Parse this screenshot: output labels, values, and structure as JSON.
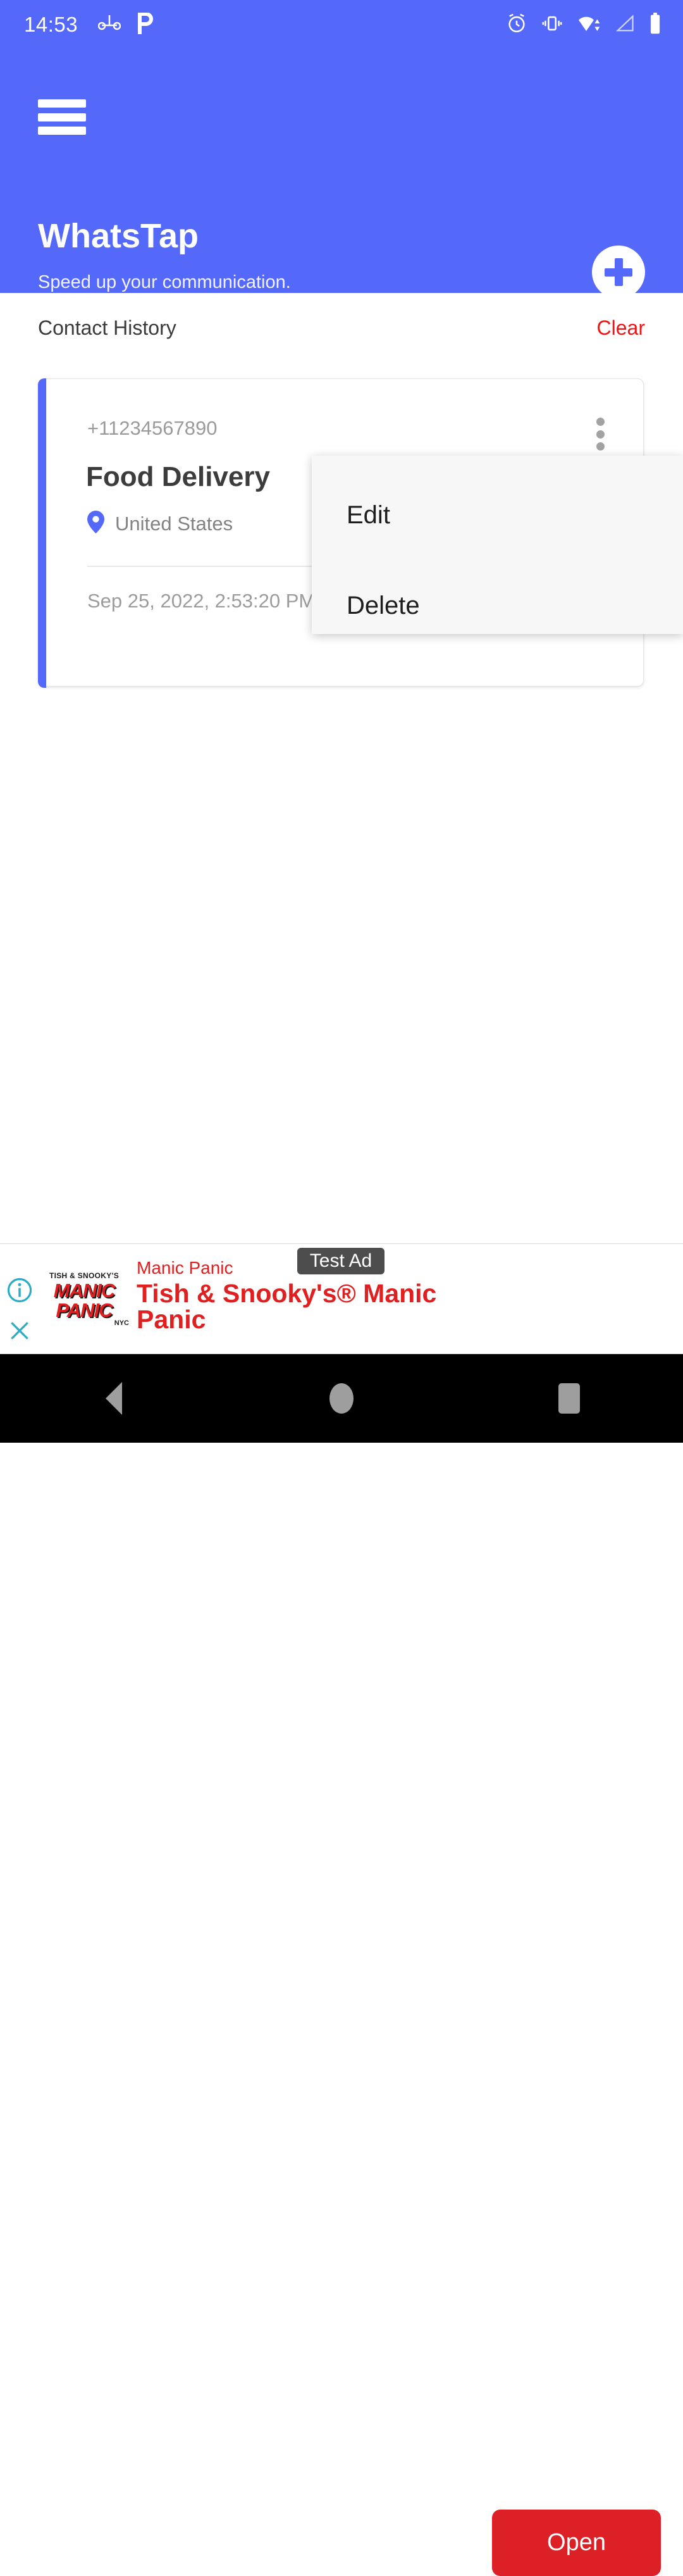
{
  "status_bar": {
    "time": "14:53",
    "left_icons": [
      "headset-icon",
      "p-app-icon"
    ],
    "right_icons": [
      "alarm-clock-icon",
      "vibrate-icon",
      "wifi-icon",
      "cell-signal-icon",
      "battery-icon"
    ]
  },
  "header": {
    "menu_icon": "hamburger-menu-icon",
    "title": "WhatsTap",
    "subtitle": "Speed up your communication.",
    "fab_icon": "plus-icon",
    "background_color": "#5468FA"
  },
  "history": {
    "title": "Contact History",
    "clear_label": "Clear",
    "clear_color": "#F01414"
  },
  "contact_card": {
    "phone": "+11234567890",
    "name": "Food Delivery",
    "location_icon": "location-pin-icon",
    "location": "United States",
    "timestamp": "Sep 25, 2022, 2:53:20 PM",
    "whatsapp_icon": "whatsapp-icon",
    "whatsapp_color": "#22bb4f",
    "overflow_icon": "more-vertical-icon",
    "accent_color": "#5468FA"
  },
  "context_menu": {
    "items": [
      {
        "label": "Edit"
      },
      {
        "label": "Delete"
      }
    ]
  },
  "ad": {
    "info_icon": "info-icon",
    "close_icon": "close-icon",
    "logo_top": "TISH & SNOOKY'S",
    "logo_line1": "MANIC",
    "logo_line2": "PANIC",
    "logo_nyc": "NYC",
    "advertiser": "Manic Panic",
    "headline": "Tish & Snooky's® Manic Panic",
    "test_badge": "Test Ad",
    "open_label": "Open",
    "brand_color": "#E02020",
    "button_color": "#DD1F26"
  },
  "nav_bar": {
    "back_icon": "back-triangle-icon",
    "home_icon": "home-circle-icon",
    "recents_icon": "recents-square-icon"
  }
}
